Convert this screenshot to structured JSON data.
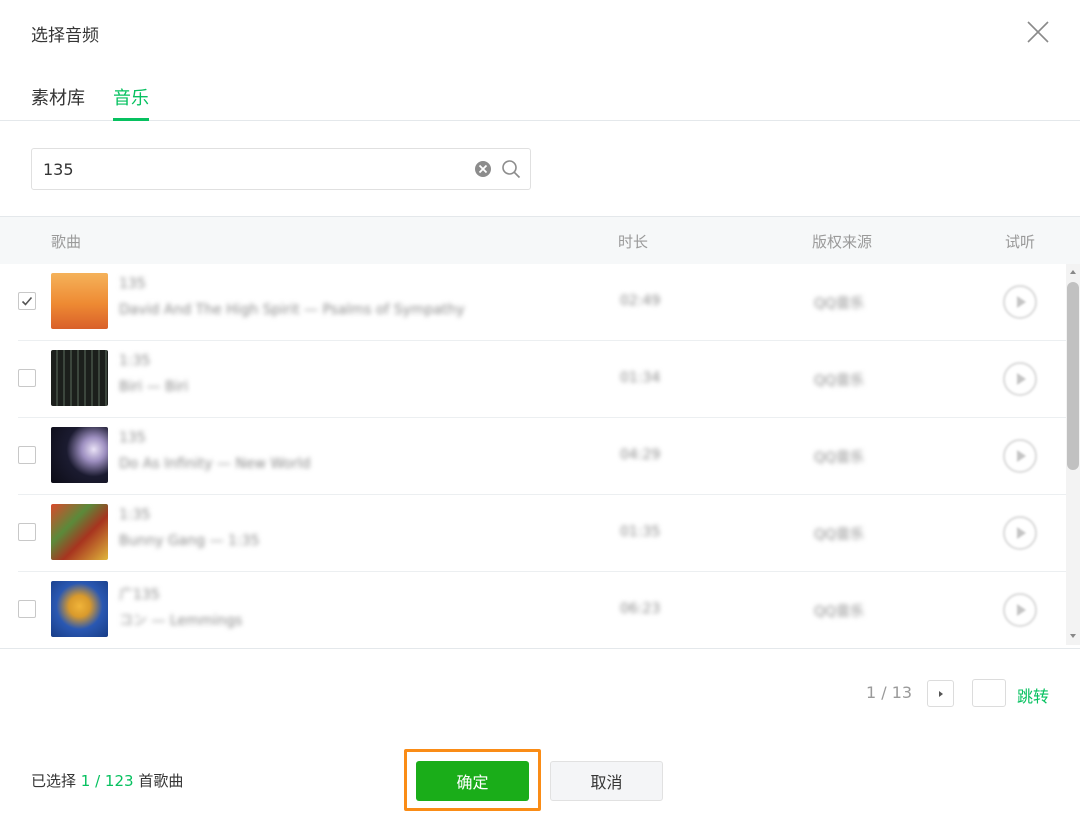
{
  "dialog": {
    "title": "选择音频"
  },
  "tabs": [
    {
      "label": "素材库",
      "active": false
    },
    {
      "label": "音乐",
      "active": true
    }
  ],
  "search": {
    "value": "135",
    "placeholder": ""
  },
  "table": {
    "columns": {
      "song": "歌曲",
      "duration": "时长",
      "source": "版权来源",
      "preview": "试听"
    },
    "rows": [
      {
        "checked": true,
        "title": "135",
        "subtitle": "David And The High Spirit — Psalms of Sympathy",
        "duration": "02:49",
        "source": "QQ音乐",
        "cover_colors": [
          "#f2a046",
          "#e06a25"
        ]
      },
      {
        "checked": false,
        "title": "1:35",
        "subtitle": "Biri — Biri",
        "duration": "01:34",
        "source": "QQ音乐",
        "cover_colors": [
          "#2a2f2b",
          "#121412"
        ]
      },
      {
        "checked": false,
        "title": "135",
        "subtitle": "Do As Infinity — New World",
        "duration": "04:29",
        "source": "QQ音乐",
        "cover_colors": [
          "#1b1b2e",
          "#cfc6e6"
        ]
      },
      {
        "checked": false,
        "title": "1:35",
        "subtitle": "Bunny Gang — 1:35",
        "duration": "01:35",
        "source": "QQ音乐",
        "cover_colors": [
          "#c43b28",
          "#3a6a2c"
        ]
      },
      {
        "checked": false,
        "title": "广135",
        "subtitle": "コン — Lemmings",
        "duration": "06:23",
        "source": "QQ音乐",
        "cover_colors": [
          "#1f4fa8",
          "#e2a830"
        ]
      }
    ]
  },
  "pagination": {
    "indicator": "1 / 13",
    "jump_label": "跳转"
  },
  "footer": {
    "selected_prefix": "已选择",
    "selected_count": "1 / 123",
    "selected_suffix": "首歌曲",
    "confirm_label": "确定",
    "cancel_label": "取消"
  },
  "colors": {
    "accent": "#07c160",
    "confirm_bg": "#1aad19",
    "highlight": "#fa8c16"
  }
}
